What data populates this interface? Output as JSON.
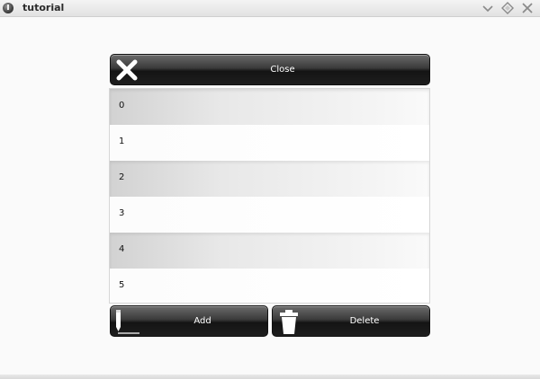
{
  "window": {
    "title": "tutorial"
  },
  "close_button": {
    "label": "Close"
  },
  "list": {
    "items": [
      "0",
      "1",
      "2",
      "3",
      "4",
      "5"
    ]
  },
  "actions": {
    "add_label": "Add",
    "delete_label": "Delete"
  },
  "icons": {
    "app": "app-icon",
    "minimize": "minimize-icon",
    "maximize": "maximize-icon",
    "window_close": "window-close-icon",
    "close": "close-icon",
    "add": "pencil-icon",
    "delete": "trash-icon"
  }
}
